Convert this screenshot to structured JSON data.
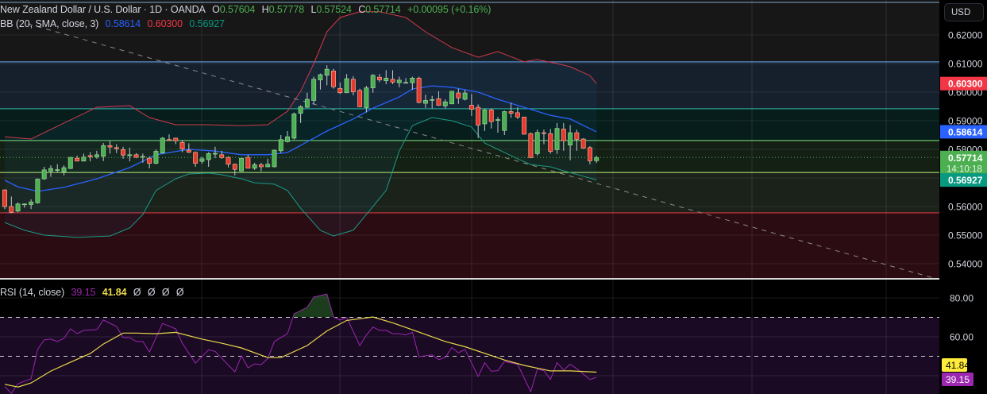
{
  "header": {
    "symbol": "New Zealand Dollar / U.S. Dollar · 1D · OANDA",
    "open_label": "O",
    "open": "0.57604",
    "high_label": "H",
    "high": "0.57778",
    "low_label": "L",
    "low": "0.57524",
    "close_label": "C",
    "close": "0.57714",
    "change": "+0.00095 (+0.16%)"
  },
  "bb_legend": {
    "label": "BB (20, SMA, close, 3)",
    "basis": "0.58614",
    "upper": "0.60300",
    "lower": "0.56927"
  },
  "rsi_legend": {
    "label": "RSI (14, close)",
    "rsi": "39.15",
    "ma": "41.84",
    "extra": [
      "Ø",
      "Ø",
      "Ø",
      "Ø"
    ]
  },
  "price_axis": {
    "currency_button": "USD",
    "ticks": [
      "0.62000",
      "0.61000",
      "0.60000",
      "0.59000",
      "0.58000",
      "0.56000",
      "0.55000",
      "0.54000"
    ],
    "labels": {
      "upper": "0.60300",
      "basis": "0.58614",
      "last": "0.57714",
      "countdown": "14:10:18",
      "lower": "0.56927"
    }
  },
  "rsi_axis": {
    "ticks": [
      "80.00",
      "60.00"
    ],
    "ma_label": "41.84",
    "rsi_label": "39.15"
  },
  "colors": {
    "up": "#4caf50",
    "down": "#e8392f",
    "bb_basis": "#2962ff",
    "bb_upper": "#d0394a",
    "bb_lower": "#1b9a86",
    "rsi": "#9c27b0",
    "rsi_ma": "#e8d84a"
  },
  "zones": [
    {
      "top": 0.6106,
      "bottom": 0.5942,
      "fill": "#16202d",
      "line": "#5b8fd0"
    },
    {
      "top": 0.5942,
      "bottom": 0.5831,
      "fill": "#071d1b",
      "line": "#2a9d8f"
    },
    {
      "top": 0.5831,
      "bottom": 0.5719,
      "fill": "#152015",
      "line": "#6abf69"
    },
    {
      "top": 0.5719,
      "bottom": 0.5578,
      "fill": "#1a221a",
      "line": "#9ccc65"
    },
    {
      "top": 0.5578,
      "bottom": 0.53,
      "fill": "#2a0c12",
      "line": "#d2343f"
    }
  ],
  "chart_data": {
    "type": "candlestick",
    "title": "New Zealand Dollar / U.S. Dollar · 1D · OANDA",
    "ylim": [
      0.53,
      0.632
    ],
    "ohlc": [
      [
        0.5658,
        0.566,
        0.5591,
        0.56
      ],
      [
        0.56,
        0.5635,
        0.5577,
        0.558
      ],
      [
        0.5584,
        0.5614,
        0.558,
        0.5609
      ],
      [
        0.5608,
        0.5611,
        0.5596,
        0.5609
      ],
      [
        0.5607,
        0.5625,
        0.5591,
        0.5616
      ],
      [
        0.5613,
        0.5698,
        0.561,
        0.5696
      ],
      [
        0.5697,
        0.5739,
        0.5693,
        0.5728
      ],
      [
        0.5724,
        0.5744,
        0.5704,
        0.5733
      ],
      [
        0.5728,
        0.5748,
        0.5721,
        0.5729
      ],
      [
        0.5721,
        0.5744,
        0.5709,
        0.5736
      ],
      [
        0.5733,
        0.5774,
        0.5731,
        0.5772
      ],
      [
        0.5769,
        0.5778,
        0.5758,
        0.5759
      ],
      [
        0.5759,
        0.5785,
        0.5758,
        0.5773
      ],
      [
        0.5778,
        0.579,
        0.5758,
        0.5774
      ],
      [
        0.5774,
        0.5795,
        0.5767,
        0.5781
      ],
      [
        0.5776,
        0.5822,
        0.5759,
        0.5813
      ],
      [
        0.5813,
        0.583,
        0.5785,
        0.5808
      ],
      [
        0.5806,
        0.5818,
        0.5787,
        0.5802
      ],
      [
        0.5799,
        0.5809,
        0.5767,
        0.578
      ],
      [
        0.578,
        0.5806,
        0.5758,
        0.5781
      ],
      [
        0.5781,
        0.5787,
        0.5769,
        0.5772
      ],
      [
        0.5774,
        0.5785,
        0.5753,
        0.5775
      ],
      [
        0.5769,
        0.5776,
        0.5734,
        0.5751
      ],
      [
        0.5751,
        0.5799,
        0.5748,
        0.5793
      ],
      [
        0.5787,
        0.5843,
        0.5785,
        0.5839
      ],
      [
        0.5834,
        0.5852,
        0.583,
        0.5832
      ],
      [
        0.5839,
        0.5841,
        0.5818,
        0.583
      ],
      [
        0.5824,
        0.5832,
        0.579,
        0.5801
      ],
      [
        0.5797,
        0.5821,
        0.5787,
        0.579
      ],
      [
        0.5789,
        0.5793,
        0.5739,
        0.5751
      ],
      [
        0.5758,
        0.5774,
        0.575,
        0.5767
      ],
      [
        0.5764,
        0.579,
        0.5739,
        0.5785
      ],
      [
        0.5785,
        0.5809,
        0.5769,
        0.5786
      ],
      [
        0.5781,
        0.5795,
        0.5767,
        0.5771
      ],
      [
        0.5772,
        0.5776,
        0.5737,
        0.5748
      ],
      [
        0.5748,
        0.575,
        0.5709,
        0.573
      ],
      [
        0.5724,
        0.577,
        0.5723,
        0.5769
      ],
      [
        0.5772,
        0.5781,
        0.5733,
        0.5734
      ],
      [
        0.5734,
        0.5753,
        0.5728,
        0.5746
      ],
      [
        0.5746,
        0.5753,
        0.5723,
        0.5739
      ],
      [
        0.5739,
        0.5767,
        0.5737,
        0.5748
      ],
      [
        0.5739,
        0.5799,
        0.5737,
        0.5797
      ],
      [
        0.5795,
        0.585,
        0.5787,
        0.5834
      ],
      [
        0.5827,
        0.5864,
        0.5824,
        0.5844
      ],
      [
        0.5839,
        0.5929,
        0.5834,
        0.5924
      ],
      [
        0.5926,
        0.5954,
        0.5892,
        0.5949
      ],
      [
        0.5947,
        0.5998,
        0.5945,
        0.5975
      ],
      [
        0.5971,
        0.6054,
        0.5957,
        0.6045
      ],
      [
        0.6043,
        0.6065,
        0.6009,
        0.6061
      ],
      [
        0.6059,
        0.6094,
        0.6024,
        0.608
      ],
      [
        0.6074,
        0.6082,
        0.6012,
        0.6019
      ],
      [
        0.6013,
        0.6034,
        0.5994,
        0.5998
      ],
      [
        0.5998,
        0.6063,
        0.5997,
        0.6047
      ],
      [
        0.6045,
        0.6056,
        0.5989,
        0.6001
      ],
      [
        0.6006,
        0.6012,
        0.5947,
        0.5949
      ],
      [
        0.5946,
        0.6022,
        0.5929,
        0.6015
      ],
      [
        0.6015,
        0.6063,
        0.5998,
        0.6059
      ],
      [
        0.6052,
        0.6063,
        0.6035,
        0.6043
      ],
      [
        0.604,
        0.6077,
        0.6028,
        0.6049
      ],
      [
        0.6045,
        0.6077,
        0.6028,
        0.6035
      ],
      [
        0.6033,
        0.6054,
        0.6017,
        0.6042
      ],
      [
        0.6033,
        0.6049,
        0.6031,
        0.6034
      ],
      [
        0.6033,
        0.6054,
        0.6008,
        0.6049
      ],
      [
        0.6049,
        0.6054,
        0.5961,
        0.5964
      ],
      [
        0.5961,
        0.5991,
        0.5945,
        0.5971
      ],
      [
        0.5973,
        0.5987,
        0.5943,
        0.5974
      ],
      [
        0.5977,
        0.6003,
        0.5952,
        0.5954
      ],
      [
        0.5952,
        0.5975,
        0.5943,
        0.5966
      ],
      [
        0.5959,
        0.6004,
        0.5958,
        0.6003
      ],
      [
        0.5997,
        0.6012,
        0.5959,
        0.598
      ],
      [
        0.5975,
        0.6008,
        0.5971,
        0.5997
      ],
      [
        0.5954,
        0.5994,
        0.5917,
        0.594
      ],
      [
        0.5947,
        0.5957,
        0.5839,
        0.5885
      ],
      [
        0.5889,
        0.5943,
        0.5864,
        0.5938
      ],
      [
        0.5938,
        0.5943,
        0.5873,
        0.5897
      ],
      [
        0.5903,
        0.5913,
        0.5858,
        0.5904
      ],
      [
        0.5866,
        0.5935,
        0.585,
        0.5932
      ],
      [
        0.5932,
        0.5963,
        0.591,
        0.5926
      ],
      [
        0.5928,
        0.5947,
        0.5906,
        0.5913
      ],
      [
        0.5913,
        0.5914,
        0.5852,
        0.5853
      ],
      [
        0.5855,
        0.5859,
        0.5769,
        0.5771
      ],
      [
        0.5785,
        0.5869,
        0.5778,
        0.5859
      ],
      [
        0.5858,
        0.5869,
        0.5818,
        0.5857
      ],
      [
        0.5855,
        0.5871,
        0.5785,
        0.5793
      ],
      [
        0.5799,
        0.5892,
        0.5784,
        0.5873
      ],
      [
        0.5871,
        0.5892,
        0.5795,
        0.583
      ],
      [
        0.5815,
        0.5885,
        0.5762,
        0.5858
      ],
      [
        0.5858,
        0.5869,
        0.5795,
        0.5835
      ],
      [
        0.5836,
        0.5839,
        0.5802,
        0.5804
      ],
      [
        0.5806,
        0.5811,
        0.5748,
        0.576
      ],
      [
        0.57604,
        0.57778,
        0.57524,
        0.57714
      ]
    ],
    "last_price": 0.57714,
    "bb_upper": [
      [
        1,
        0.5844
      ],
      [
        5,
        0.5836
      ],
      [
        10,
        0.5892
      ],
      [
        15,
        0.5947
      ],
      [
        20,
        0.5953
      ],
      [
        23,
        0.5911
      ],
      [
        27,
        0.5886
      ],
      [
        32,
        0.5886
      ],
      [
        37,
        0.5883
      ],
      [
        41,
        0.5886
      ],
      [
        44,
        0.5933
      ],
      [
        46,
        0.6003
      ],
      [
        48,
        0.61
      ],
      [
        50,
        0.6211
      ],
      [
        52,
        0.6261
      ],
      [
        55,
        0.6281
      ],
      [
        58,
        0.6281
      ],
      [
        62,
        0.6261
      ],
      [
        65,
        0.6211
      ],
      [
        69,
        0.6156
      ],
      [
        73,
        0.6122
      ],
      [
        76,
        0.6142
      ],
      [
        80,
        0.6106
      ],
      [
        82,
        0.6114
      ],
      [
        85,
        0.61
      ],
      [
        87,
        0.6089
      ],
      [
        90,
        0.6058
      ],
      [
        91,
        0.603
      ]
    ],
    "bb_basis": [
      [
        1,
        0.5692
      ],
      [
        3,
        0.5669
      ],
      [
        6,
        0.5653
      ],
      [
        10,
        0.5667
      ],
      [
        15,
        0.5697
      ],
      [
        20,
        0.5736
      ],
      [
        24,
        0.5781
      ],
      [
        29,
        0.58
      ],
      [
        33,
        0.5794
      ],
      [
        37,
        0.5781
      ],
      [
        41,
        0.5781
      ],
      [
        44,
        0.5789
      ],
      [
        46,
        0.5814
      ],
      [
        50,
        0.5864
      ],
      [
        54,
        0.5906
      ],
      [
        57,
        0.5944
      ],
      [
        61,
        0.5983
      ],
      [
        63,
        0.6011
      ],
      [
        66,
        0.6022
      ],
      [
        69,
        0.6017
      ],
      [
        73,
        0.6
      ],
      [
        76,
        0.5975
      ],
      [
        80,
        0.5947
      ],
      [
        84,
        0.5919
      ],
      [
        87,
        0.5906
      ],
      [
        91,
        0.58614
      ]
    ],
    "bb_lower": [
      [
        1,
        0.5544
      ],
      [
        4,
        0.5517
      ],
      [
        7,
        0.55
      ],
      [
        12,
        0.5492
      ],
      [
        17,
        0.5497
      ],
      [
        20,
        0.5525
      ],
      [
        22,
        0.5572
      ],
      [
        24,
        0.5656
      ],
      [
        27,
        0.5697
      ],
      [
        29,
        0.5714
      ],
      [
        32,
        0.5717
      ],
      [
        34,
        0.5711
      ],
      [
        37,
        0.5697
      ],
      [
        39,
        0.5683
      ],
      [
        42,
        0.5678
      ],
      [
        44,
        0.5656
      ],
      [
        46,
        0.5594
      ],
      [
        49,
        0.5517
      ],
      [
        51,
        0.5497
      ],
      [
        54,
        0.5517
      ],
      [
        56,
        0.5572
      ],
      [
        59,
        0.5656
      ],
      [
        61,
        0.5794
      ],
      [
        63,
        0.5883
      ],
      [
        66,
        0.5911
      ],
      [
        69,
        0.59
      ],
      [
        72,
        0.5878
      ],
      [
        74,
        0.5822
      ],
      [
        76,
        0.58
      ],
      [
        79,
        0.5767
      ],
      [
        81,
        0.5747
      ],
      [
        84,
        0.5739
      ],
      [
        86,
        0.5725
      ],
      [
        89,
        0.5706
      ],
      [
        91,
        0.56927
      ]
    ],
    "rsi": [
      [
        1,
        34.4
      ],
      [
        2,
        31
      ],
      [
        3,
        35.9
      ],
      [
        5,
        38.4
      ],
      [
        6,
        53.5
      ],
      [
        7,
        58.4
      ],
      [
        8,
        58.8
      ],
      [
        9,
        57.6
      ],
      [
        10,
        59.2
      ],
      [
        11,
        64.1
      ],
      [
        12,
        61.6
      ],
      [
        13,
        63.3
      ],
      [
        15,
        63.7
      ],
      [
        16,
        68.6
      ],
      [
        18,
        65.3
      ],
      [
        19,
        59.6
      ],
      [
        20,
        59.6
      ],
      [
        21,
        57.6
      ],
      [
        22,
        57.6
      ],
      [
        23,
        52.2
      ],
      [
        25,
        66.9
      ],
      [
        27,
        64.1
      ],
      [
        28,
        56.7
      ],
      [
        30,
        46.5
      ],
      [
        32,
        53.3
      ],
      [
        33,
        52.5
      ],
      [
        36,
        42
      ],
      [
        37,
        50.2
      ],
      [
        38,
        44.1
      ],
      [
        39,
        46.1
      ],
      [
        40,
        45.7
      ],
      [
        41,
        48.8
      ],
      [
        42,
        57.6
      ],
      [
        44,
        61.6
      ],
      [
        45,
        71.8
      ],
      [
        47,
        75.2
      ],
      [
        48,
        80.4
      ],
      [
        50,
        82
      ],
      [
        51,
        70.2
      ],
      [
        52,
        68.6
      ],
      [
        53,
        70
      ],
      [
        55,
        55.5
      ],
      [
        56,
        60.9
      ],
      [
        57,
        65
      ],
      [
        58,
        63.3
      ],
      [
        59,
        63.3
      ],
      [
        60,
        61.6
      ],
      [
        61,
        61.6
      ],
      [
        62,
        61
      ],
      [
        63,
        62.3
      ],
      [
        64,
        49.8
      ],
      [
        66,
        50.7
      ],
      [
        67,
        48.3
      ],
      [
        68,
        49.4
      ],
      [
        69,
        54.5
      ],
      [
        70,
        51.8
      ],
      [
        71,
        53.5
      ],
      [
        73,
        39.6
      ],
      [
        74,
        46.7
      ],
      [
        75,
        42.3
      ],
      [
        76,
        42.6
      ],
      [
        77,
        47.3
      ],
      [
        79,
        45.9
      ],
      [
        81,
        31.8
      ],
      [
        82,
        43.4
      ],
      [
        83,
        42.6
      ],
      [
        84,
        38.1
      ],
      [
        85,
        46.7
      ],
      [
        86,
        42.9
      ],
      [
        87,
        45.9
      ],
      [
        88,
        43.6
      ],
      [
        90,
        38.1
      ],
      [
        91,
        39.15
      ]
    ],
    "rsi_ma": [
      [
        1,
        35.6
      ],
      [
        3,
        34.2
      ],
      [
        5,
        36.3
      ],
      [
        8,
        42.4
      ],
      [
        11,
        47
      ],
      [
        14,
        51.4
      ],
      [
        16,
        56.3
      ],
      [
        19,
        61.9
      ],
      [
        21,
        61.9
      ],
      [
        24,
        61.6
      ],
      [
        27,
        62.3
      ],
      [
        31,
        58.8
      ],
      [
        34,
        56.7
      ],
      [
        37,
        54.3
      ],
      [
        41,
        49.3
      ],
      [
        43,
        49.3
      ],
      [
        47,
        55.5
      ],
      [
        50,
        63
      ],
      [
        53,
        68.4
      ],
      [
        57,
        70.2
      ],
      [
        60,
        67.2
      ],
      [
        64,
        62.4
      ],
      [
        68,
        57.6
      ],
      [
        71,
        54.9
      ],
      [
        77,
        48.1
      ],
      [
        80,
        45.3
      ],
      [
        84,
        42.5
      ],
      [
        87,
        42.5
      ],
      [
        91,
        41.84
      ]
    ],
    "rsi_levels": {
      "upper": 70,
      "lower": 50
    },
    "rsi_ylim": [
      30,
      90
    ]
  }
}
